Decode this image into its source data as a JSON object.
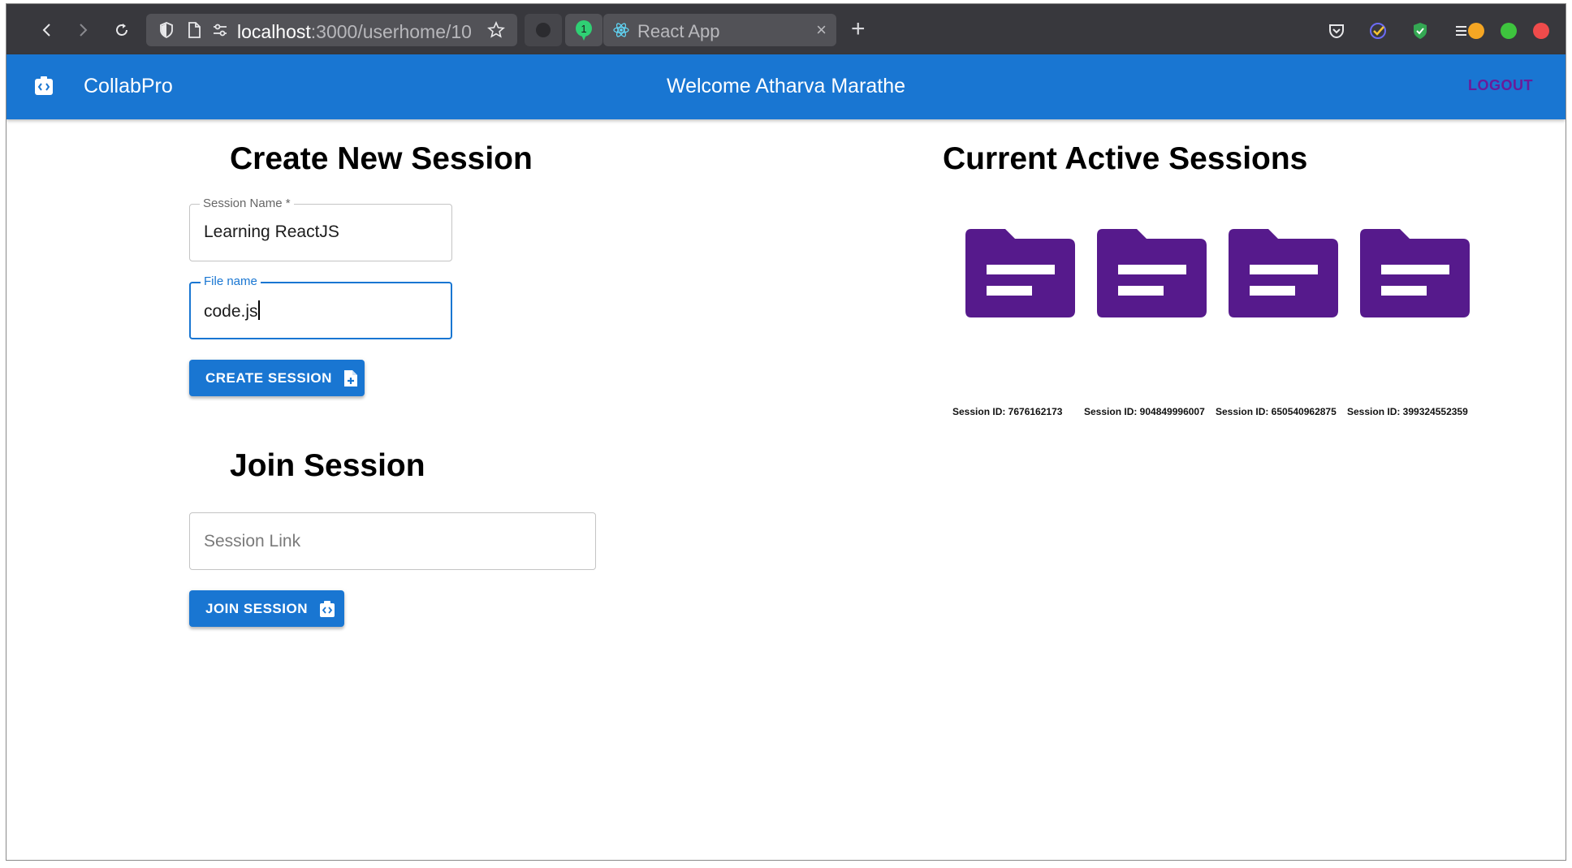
{
  "browser": {
    "url_host": "localhost",
    "url_rest": ":3000/userhome/10",
    "tab_title": "React App",
    "tab_close": "×",
    "new_tab": "+",
    "badge_count": "1"
  },
  "header": {
    "brand": "CollabPro",
    "welcome": "Welcome Atharva Marathe",
    "logout": "LOGOUT",
    "color": "#1976d2"
  },
  "create": {
    "title": "Create New Session",
    "session_name_label": "Session Name *",
    "session_name_value": "Learning ReactJS",
    "file_name_label": "File name",
    "file_name_value": "code.js",
    "button_label": "CREATE SESSION"
  },
  "join": {
    "title": "Join Session",
    "placeholder": "Session Link",
    "button_label": "JOIN SESSION"
  },
  "sessions": {
    "title": "Current Active Sessions",
    "folder_color": "#561a8c",
    "items": [
      {
        "label": "Session ID: 7676162173"
      },
      {
        "label": "Session ID: 904849996007"
      },
      {
        "label": "Session ID: 650540962875"
      },
      {
        "label": "Session ID: 399324552359"
      }
    ]
  }
}
